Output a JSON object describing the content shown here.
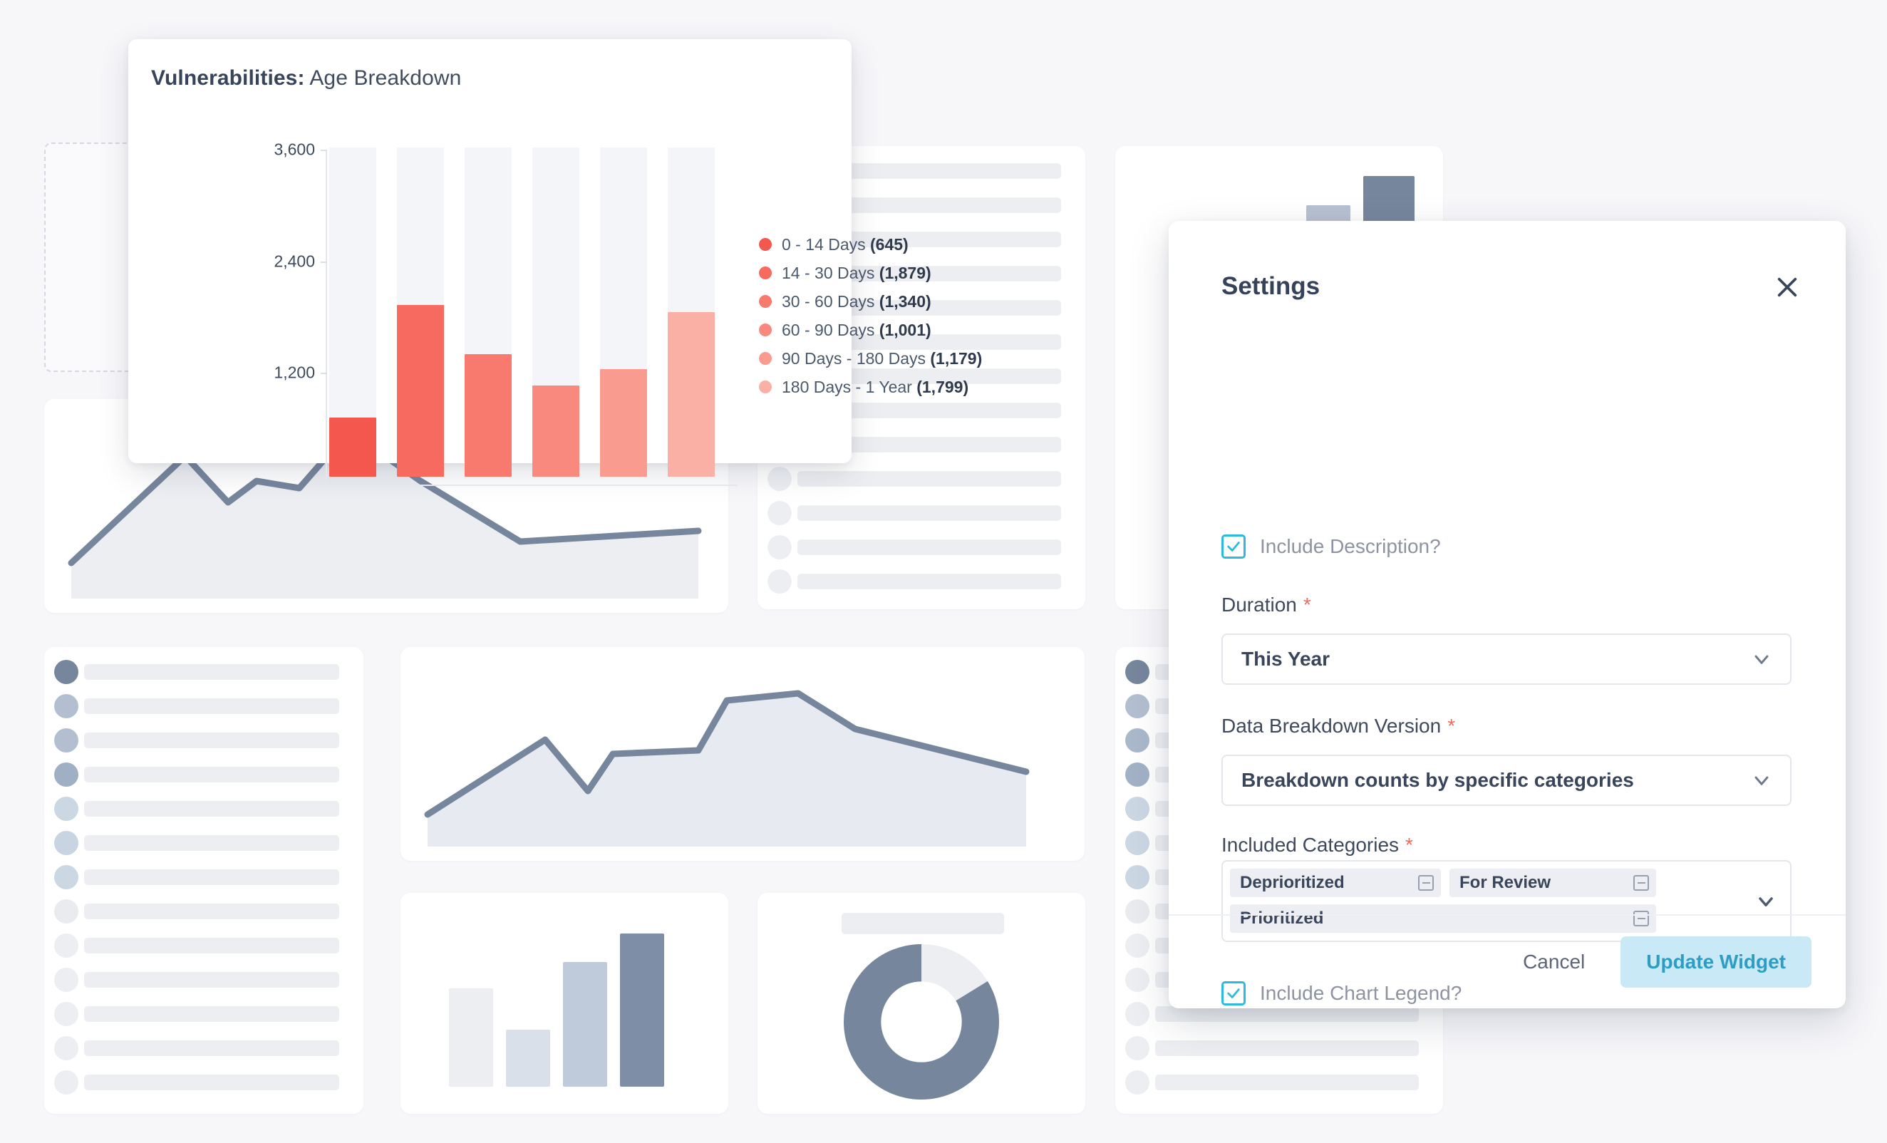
{
  "widget": {
    "title_bold": "Vulnerabilities:",
    "title_rest": " Age Breakdown"
  },
  "chart_data": {
    "type": "bar",
    "title": "Vulnerabilities: Age Breakdown",
    "xlabel": "",
    "ylabel": "",
    "ylim": [
      0,
      3600
    ],
    "ytick_labels": [
      "3,600",
      "2,400",
      "1,200"
    ],
    "ytick_values": [
      3600,
      2400,
      1200
    ],
    "grid": false,
    "legend_position": "right",
    "categories": [
      "0 - 14 Days",
      "14 - 30 Days",
      "30 - 60 Days",
      "60 - 90 Days",
      "90 Days - 180 Days",
      "180 Days - 1 Year"
    ],
    "values": [
      645,
      1879,
      1340,
      1001,
      1179,
      1799
    ],
    "value_labels": [
      "645",
      "1,879",
      "1,340",
      "1,001",
      "1,179",
      "1,799"
    ],
    "colors": [
      "#f4574d",
      "#f66a5f",
      "#f87a6f",
      "#f9897e",
      "#fa9b90",
      "#fbb0a5"
    ],
    "track_color": "#f4f5f9",
    "legend": [
      {
        "label": "0 - 14 Days",
        "value": "(645)",
        "color": "#f4574d"
      },
      {
        "label": "14 - 30 Days",
        "value": "(1,879)",
        "color": "#f66a5f"
      },
      {
        "label": "30 - 60 Days",
        "value": "(1,340)",
        "color": "#f87a6f"
      },
      {
        "label": "60 - 90 Days",
        "value": "(1,001)",
        "color": "#f9897e"
      },
      {
        "label": "90 Days - 180 Days",
        "value": "(1,179)",
        "color": "#fa9b90"
      },
      {
        "label": "180 Days - 1 Year",
        "value": "(1,799)",
        "color": "#fbb0a5"
      }
    ]
  },
  "modal": {
    "title": "Settings",
    "close_icon": "close-icon",
    "include_description": {
      "label": "Include Description?",
      "checked": true
    },
    "duration": {
      "label": "Duration",
      "required_marker": "*",
      "value": "This Year",
      "chevron_icon": "chevron-down-icon"
    },
    "breakdown_version": {
      "label": "Data Breakdown Version",
      "required_marker": "*",
      "value": "Breakdown counts by specific categories",
      "chevron_icon": "chevron-down-icon"
    },
    "included_categories": {
      "label": "Included Categories",
      "required_marker": "*",
      "chevron_icon": "chevron-down-icon",
      "tags": [
        {
          "label": "Deprioritized",
          "remove_icon": "minus-box-icon"
        },
        {
          "label": "For Review",
          "remove_icon": "minus-box-icon"
        },
        {
          "label": "Prioritized",
          "remove_icon": "minus-box-icon"
        }
      ]
    },
    "include_chart_legend": {
      "label": "Include Chart Legend?",
      "checked": true
    },
    "footer": {
      "cancel_label": "Cancel",
      "submit_label": "Update Widget",
      "submit_bg": "#c8e9f5",
      "submit_fg": "#2d9dc4"
    }
  },
  "theme": {
    "page_bg": "#f7f7fa",
    "card_bg": "#ffffff",
    "skeleton": "#eceef2",
    "slate": "#76869d",
    "accent_cyan": "#2cbbdd",
    "required_red": "#f26a5e"
  }
}
